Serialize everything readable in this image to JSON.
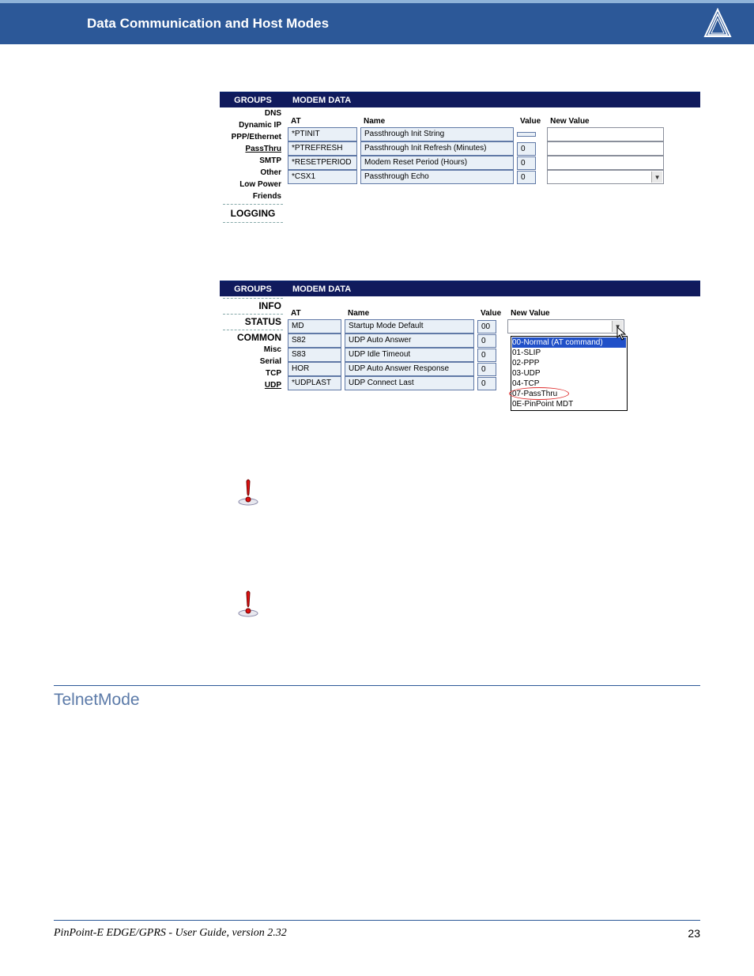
{
  "header": {
    "title": "Data Communication  and Host Modes"
  },
  "screenshot1": {
    "groups_header": "GROUPS",
    "modem_header": "MODEM DATA",
    "sidebar": {
      "items": [
        {
          "label": "DNS",
          "underline": false
        },
        {
          "label": "Dynamic IP",
          "underline": false
        },
        {
          "label": "PPP/Ethernet",
          "underline": false
        },
        {
          "label": "PassThru",
          "underline": true
        },
        {
          "label": "SMTP",
          "underline": false
        },
        {
          "label": "Other",
          "underline": false
        },
        {
          "label": "Low Power",
          "underline": false
        },
        {
          "label": "Friends",
          "underline": false
        }
      ],
      "logging": "LOGGING"
    },
    "cols": {
      "at": "AT",
      "name": "Name",
      "value": "Value",
      "newv": "New Value"
    },
    "rows": [
      {
        "at": "*PTINIT",
        "name": "Passthrough Init String",
        "value": "",
        "type": "text"
      },
      {
        "at": "*PTREFRESH",
        "name": "Passthrough Init Refresh (Minutes)",
        "value": "0",
        "type": "text"
      },
      {
        "at": "*RESETPERIOD",
        "name": "Modem Reset Period (Hours)",
        "value": "0",
        "type": "text"
      },
      {
        "at": "*CSX1",
        "name": "Passthrough Echo",
        "value": "0",
        "type": "select"
      }
    ]
  },
  "screenshot2": {
    "groups_header": "GROUPS",
    "modem_header": "MODEM DATA",
    "sidebar": {
      "items": [
        {
          "label": "INFO",
          "underline": true,
          "big": true
        },
        {
          "label": "STATUS",
          "underline": true,
          "big": true
        },
        {
          "label": "COMMON",
          "underline": true,
          "big": true
        },
        {
          "label": "Misc",
          "underline": false
        },
        {
          "label": "Serial",
          "underline": false
        },
        {
          "label": "TCP",
          "underline": false
        },
        {
          "label": "UDP",
          "underline": true,
          "bold": true
        }
      ]
    },
    "cols": {
      "at": "AT",
      "name": "Name",
      "value": "Value",
      "newv": "New Value"
    },
    "rows": [
      {
        "at": "MD",
        "name": "Startup Mode Default",
        "value": "00",
        "type": "select"
      },
      {
        "at": "S82",
        "name": "UDP Auto Answer",
        "value": "0",
        "type": ""
      },
      {
        "at": "S83",
        "name": "UDP Idle Timeout",
        "value": "0",
        "type": ""
      },
      {
        "at": "HOR",
        "name": "UDP Auto Answer Response",
        "value": "0",
        "type": ""
      },
      {
        "at": "*UDPLAST",
        "name": "UDP Connect Last",
        "value": "0",
        "type": ""
      }
    ],
    "dropdown": {
      "options": [
        "00-Normal (AT command)",
        "01-SLIP",
        "02-PPP",
        "03-UDP",
        "04-TCP",
        "07-PassThru",
        "0E-PinPoint MDT"
      ],
      "selected_index": 0,
      "circled_index": 5
    }
  },
  "telnet": {
    "heading": "TelnetMode"
  },
  "footer": {
    "left": "PinPoint-E EDGE/GPRS - User Guide, version 2.32",
    "page": "23"
  }
}
